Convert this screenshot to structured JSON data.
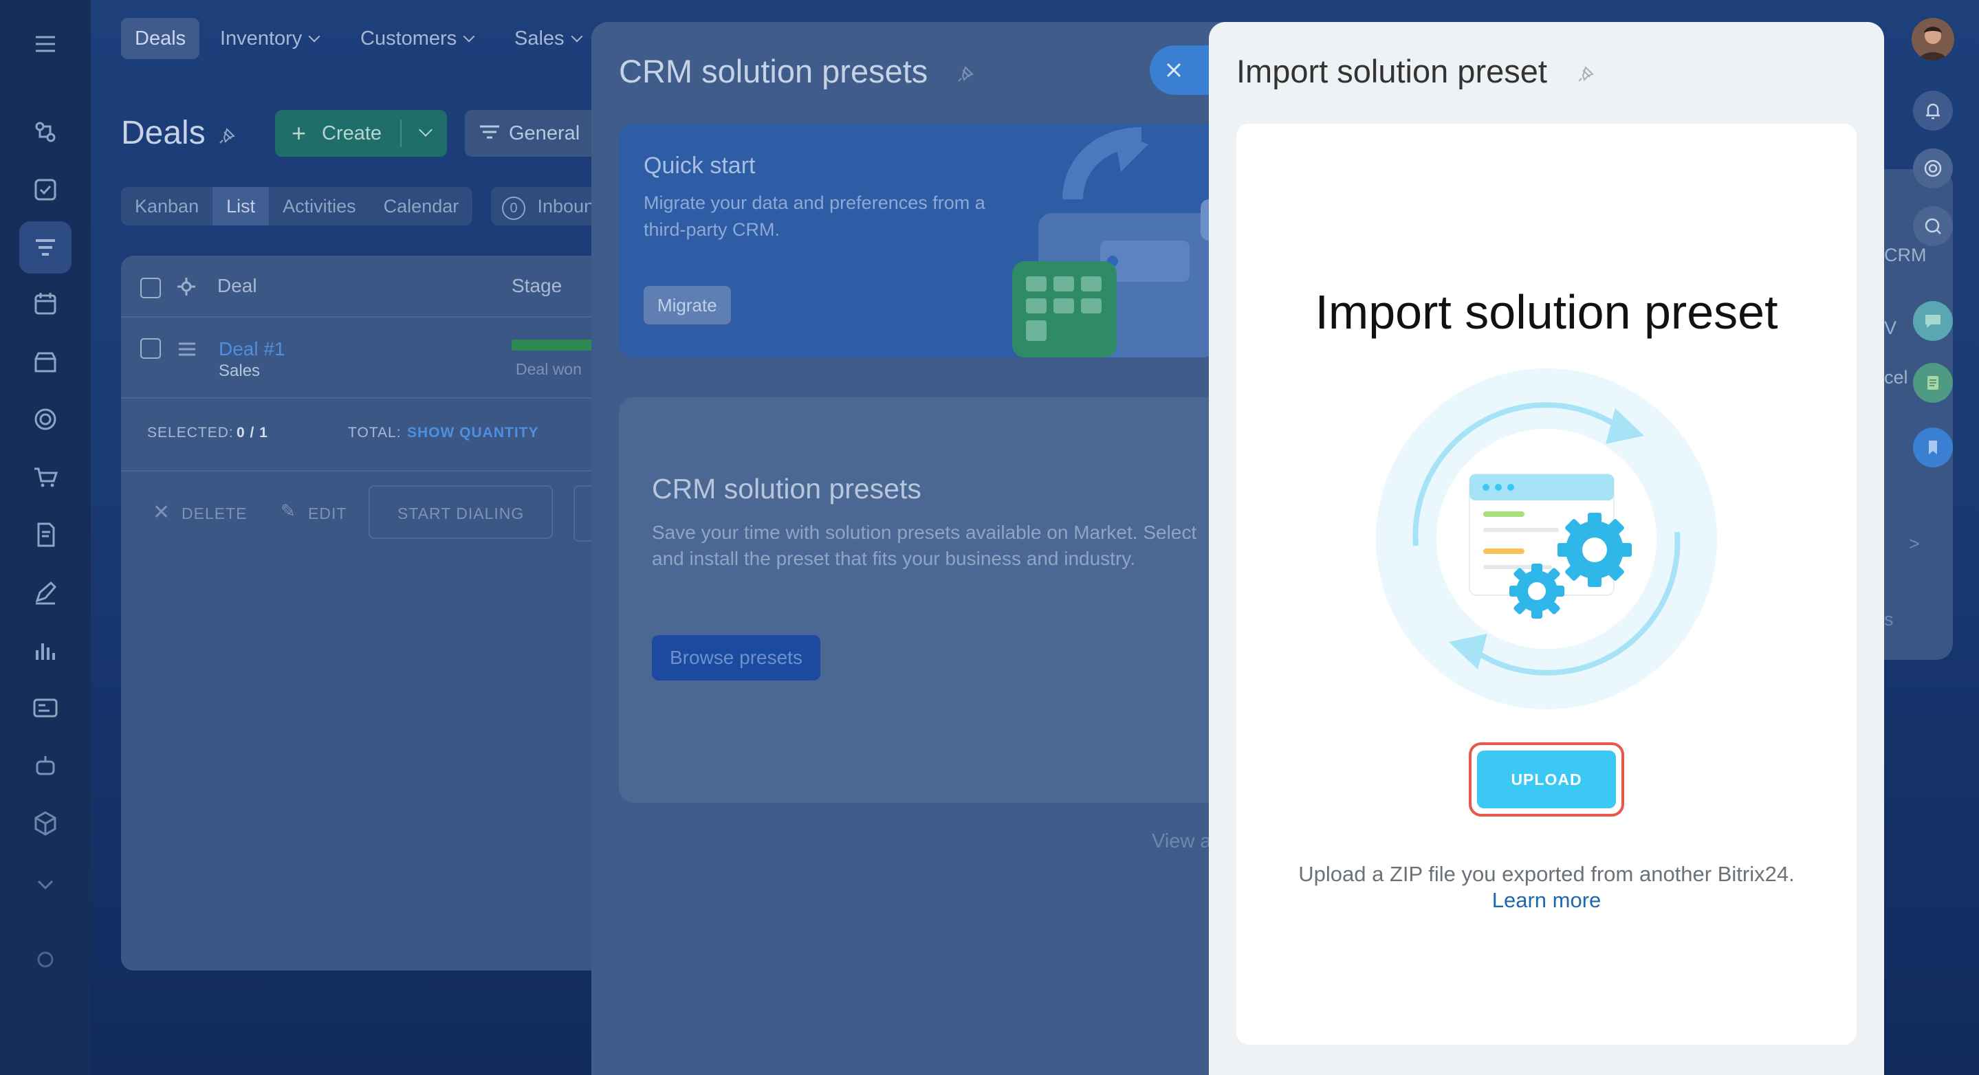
{
  "top_menu": {
    "items": [
      {
        "label": "Deals",
        "active": true
      },
      {
        "label": "Inventory"
      },
      {
        "label": "Customers"
      },
      {
        "label": "Sales"
      }
    ]
  },
  "deals": {
    "title": "Deals",
    "create_label": "Create",
    "filter_label": "General",
    "view_tabs": [
      "Kanban",
      "List",
      "Activities",
      "Calendar"
    ],
    "inbound_count": "0",
    "inbound_label": "Inbound",
    "grid": {
      "col_deal": "Deal",
      "col_stage": "Stage",
      "row": {
        "name": "Deal #1",
        "pipeline": "Sales",
        "stage": "Deal won"
      },
      "selected_label": "SELECTED:",
      "selected_value": "0 / 1",
      "total_label": "TOTAL:",
      "total_link": "SHOW QUANTITY",
      "actions": [
        "DELETE",
        "EDIT",
        "START DIALING"
      ]
    }
  },
  "crm_presets_panel": {
    "title": "CRM solution presets",
    "quick_start": {
      "title": "Quick start",
      "description": "Migrate your data and preferences from a third-party CRM.",
      "button": "Migrate"
    },
    "presets": {
      "title": "CRM solution presets",
      "description": "Save your time with solution presets available on Market. Select and install the preset that fits your business and industry.",
      "button": "Browse presets"
    },
    "view_link": "View a"
  },
  "import_panel": {
    "title": "Import solution preset",
    "heading": "Import solution preset",
    "upload_button": "UPLOAD",
    "description": "Upload a ZIP file you exported from another Bitrix24.",
    "learn_more": "Learn more"
  },
  "right_bar": {
    "labels": [
      "CRM",
      "V",
      "cel",
      ">",
      "s"
    ]
  },
  "colors": {
    "upload": "#3bc8f5",
    "upload_highlight": "#e8584a",
    "link": "#2067b0",
    "create": "#1f6e6a"
  }
}
